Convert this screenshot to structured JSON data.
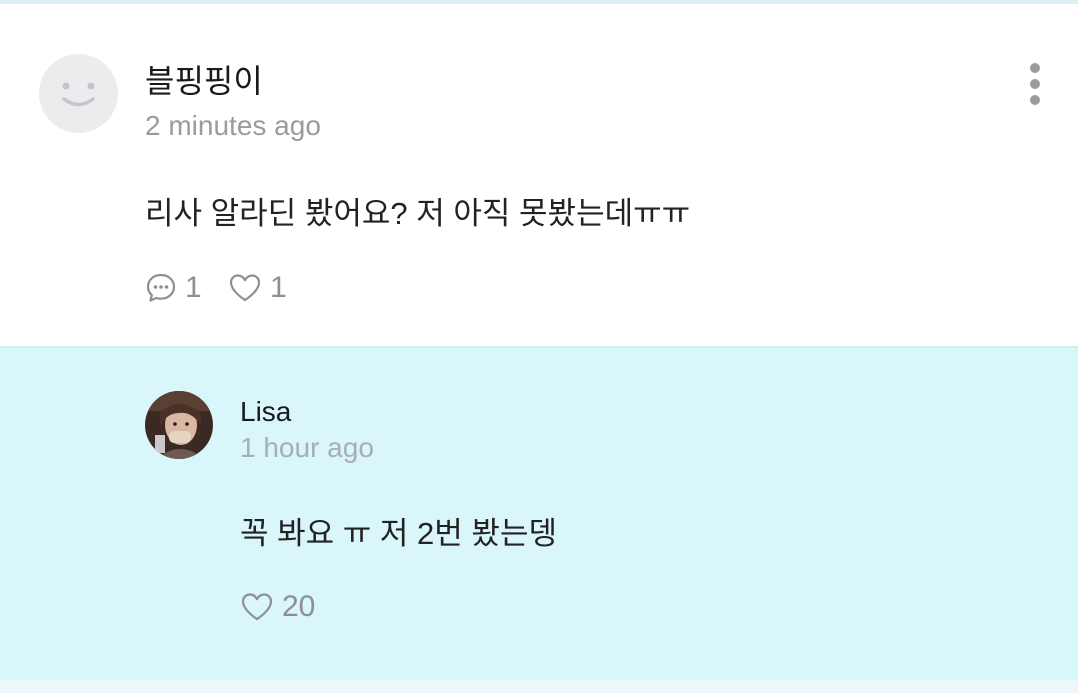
{
  "comment": {
    "author": "블핑핑이",
    "time": "2 minutes ago",
    "text": "리사 알라딘 봤어요? 저 아직 못봤는데ㅠㅠ",
    "reply_count": "1",
    "like_count": "1",
    "avatar_icon": "default-smiley-avatar",
    "more_icon": "more-vertical-icon"
  },
  "reply": {
    "author": "Lisa",
    "time": "1 hour ago",
    "text": "꼭 봐요 ㅠ 저 2번 봤는뎅",
    "like_count": "20",
    "avatar_icon": "profile-photo-avatar"
  },
  "colors": {
    "reply_background": "#d9f6fb",
    "divider": "#cdeef3",
    "meta_text": "#9a9aa1",
    "icon": "#8e8e95"
  }
}
